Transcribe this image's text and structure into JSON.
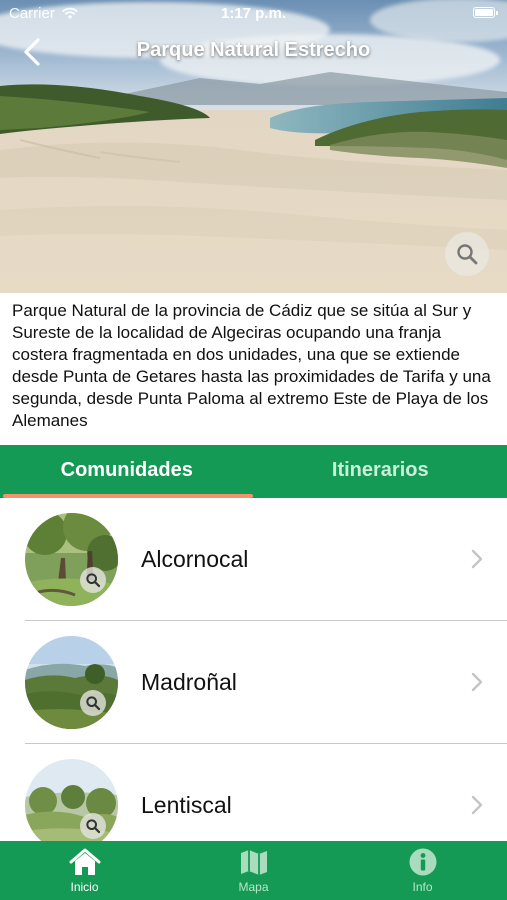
{
  "status_bar": {
    "carrier": "Carrier",
    "time": "1:17 p.m."
  },
  "nav": {
    "title": "Parque Natural Estrecho"
  },
  "description": "Parque Natural de la provincia de Cádiz que se sitúa al Sur y Sureste de la localidad de Algeciras ocupando una franja costera fragmentada en dos unidades, una que se extiende desde Punta de Getares hasta las proximidades de Tarifa y una segunda, desde Punta Paloma al extremo Este de Playa de los Alemanes",
  "tabs": [
    {
      "label": "Comunidades",
      "active": true
    },
    {
      "label": "Itinerarios",
      "active": false
    }
  ],
  "communities": [
    {
      "label": "Alcornocal"
    },
    {
      "label": "Madroñal"
    },
    {
      "label": "Lentiscal"
    }
  ],
  "tabbar": [
    {
      "label": "Inicio",
      "icon": "home-icon",
      "active": true
    },
    {
      "label": "Mapa",
      "icon": "map-icon",
      "active": false
    },
    {
      "label": "Info",
      "icon": "info-icon",
      "active": false
    }
  ],
  "colors": {
    "primary_green": "#149a55",
    "tab_indicator": "#f0956b"
  }
}
